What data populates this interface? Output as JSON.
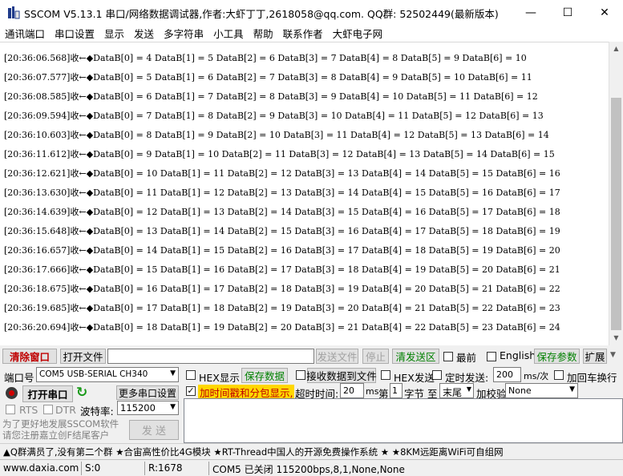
{
  "window": {
    "title": "SSCOM V5.13.1 串口/网络数据调试器,作者:大虾丁丁,2618058@qq.com. QQ群: 52502449(最新版本)",
    "minimize": "—",
    "maximize": "☐",
    "close": "✕"
  },
  "menu": [
    "通讯端口",
    "串口设置",
    "显示",
    "发送",
    "多字符串",
    "小工具",
    "帮助",
    "联系作者",
    "大虾电子网"
  ],
  "log": [
    "[20:36:06.568]收←◆DataB[0] = 4 DataB[1] = 5 DataB[2] = 6 DataB[3] = 7 DataB[4] = 8 DataB[5] = 9 DataB[6] = 10",
    "[20:36:07.577]收←◆DataB[0] = 5 DataB[1] = 6 DataB[2] = 7 DataB[3] = 8 DataB[4] = 9 DataB[5] = 10 DataB[6] = 11",
    "[20:36:08.585]收←◆DataB[0] = 6 DataB[1] = 7 DataB[2] = 8 DataB[3] = 9 DataB[4] = 10 DataB[5] = 11 DataB[6] = 12",
    "[20:36:09.594]收←◆DataB[0] = 7 DataB[1] = 8 DataB[2] = 9 DataB[3] = 10 DataB[4] = 11 DataB[5] = 12 DataB[6] = 13",
    "[20:36:10.603]收←◆DataB[0] = 8 DataB[1] = 9 DataB[2] = 10 DataB[3] = 11 DataB[4] = 12 DataB[5] = 13 DataB[6] = 14",
    "[20:36:11.612]收←◆DataB[0] = 9 DataB[1] = 10 DataB[2] = 11 DataB[3] = 12 DataB[4] = 13 DataB[5] = 14 DataB[6] = 15",
    "[20:36:12.621]收←◆DataB[0] = 10 DataB[1] = 11 DataB[2] = 12 DataB[3] = 13 DataB[4] = 14 DataB[5] = 15 DataB[6] = 16",
    "[20:36:13.630]收←◆DataB[0] = 11 DataB[1] = 12 DataB[2] = 13 DataB[3] = 14 DataB[4] = 15 DataB[5] = 16 DataB[6] = 17",
    "[20:36:14.639]收←◆DataB[0] = 12 DataB[1] = 13 DataB[2] = 14 DataB[3] = 15 DataB[4] = 16 DataB[5] = 17 DataB[6] = 18",
    "[20:36:15.648]收←◆DataB[0] = 13 DataB[1] = 14 DataB[2] = 15 DataB[3] = 16 DataB[4] = 17 DataB[5] = 18 DataB[6] = 19",
    "[20:36:16.657]收←◆DataB[0] = 14 DataB[1] = 15 DataB[2] = 16 DataB[3] = 17 DataB[4] = 18 DataB[5] = 19 DataB[6] = 20",
    "[20:36:17.666]收←◆DataB[0] = 15 DataB[1] = 16 DataB[2] = 17 DataB[3] = 18 DataB[4] = 19 DataB[5] = 20 DataB[6] = 21",
    "[20:36:18.675]收←◆DataB[0] = 16 DataB[1] = 17 DataB[2] = 18 DataB[3] = 19 DataB[4] = 20 DataB[5] = 21 DataB[6] = 22",
    "[20:36:19.685]收←◆DataB[0] = 17 DataB[1] = 18 DataB[2] = 19 DataB[3] = 20 DataB[4] = 21 DataB[5] = 22 DataB[6] = 23",
    "[20:36:20.694]收←◆DataB[0] = 18 DataB[1] = 19 DataB[2] = 20 DataB[3] = 21 DataB[4] = 22 DataB[5] = 23 DataB[6] = 24"
  ],
  "toolbar1": {
    "clear_window": "清除窗口",
    "open_file": "打开文件",
    "send_file": "发送文件",
    "stop": "停止",
    "clear_send": "清发送区",
    "latest": "最前",
    "english": "English",
    "save_params": "保存参数",
    "expand": "扩展"
  },
  "toolbar2": {
    "port_label": "端口号",
    "port_value": "COM5 USB-SERIAL CH340",
    "hex_display": "HEX显示",
    "save_data": "保存数据",
    "recv_to_file": "接收数据到文件",
    "hex_send": "HEX发送",
    "timed_send": "定时发送:",
    "interval": "200",
    "interval_unit": "ms/次",
    "add_crlf": "加回车换行"
  },
  "toolbar3": {
    "open_port": "打开串口",
    "more_settings": "更多串口设置",
    "timestamp_pack": "加时间戳和分包显示,",
    "timeout_label": "超时时间:",
    "timeout_value": "20",
    "timeout_unit": "ms",
    "byte_no_label": "第",
    "byte_no_value": "1",
    "byte_label": "字节",
    "to_label": "至",
    "to_value": "末尾",
    "checksum_label": "加校验",
    "checksum_value": "None"
  },
  "toolbar4": {
    "rts": "RTS",
    "dtr": "DTR",
    "baud_label": "波特率:",
    "baud_value": "115200"
  },
  "promo": {
    "line1": "为了更好地发展SSCOM软件",
    "line2": "请您注册嘉立创F结尾客户",
    "send": "发 送"
  },
  "ticker": "▲Q群满员了,没有第二个群 ★合宙高性价比4G模块 ★RT-Thread中国人的开源免费操作系统 ★ ★8KM远距离WiFi可自组网",
  "status": {
    "website": "www.daxia.com",
    "sent": "S:0",
    "received": "R:1678",
    "port_state": "COM5 已关闭  115200bps,8,1,None,None"
  },
  "colors": {
    "accent_red": "#c00000",
    "accent_green": "#008000",
    "open_port_dot": "#d00000"
  }
}
